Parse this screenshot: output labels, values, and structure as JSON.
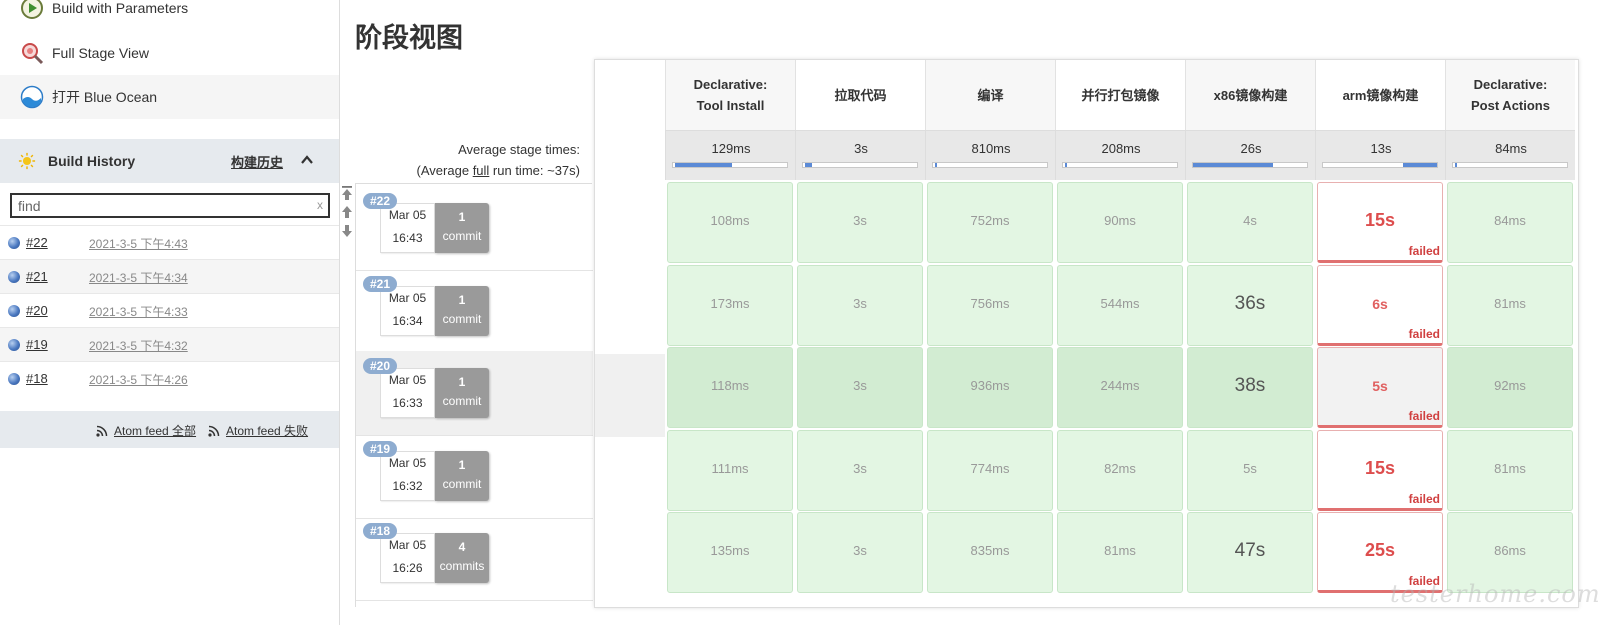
{
  "sidebar": {
    "tasks": [
      {
        "label": "Build with Parameters",
        "icon": "clock-play-icon"
      },
      {
        "label": "Full Stage View",
        "icon": "magnifier-icon"
      },
      {
        "label": "打开 Blue Ocean",
        "icon": "blue-ocean-icon"
      }
    ],
    "build_history": {
      "title": "Build History",
      "trend_label": "构建历史",
      "search_value": "find",
      "search_clear": "x",
      "builds": [
        {
          "number": "#22",
          "date": "2021-3-5 下午4:43"
        },
        {
          "number": "#21",
          "date": "2021-3-5 下午4:34"
        },
        {
          "number": "#20",
          "date": "2021-3-5 下午4:33"
        },
        {
          "number": "#19",
          "date": "2021-3-5 下午4:32"
        },
        {
          "number": "#18",
          "date": "2021-3-5 下午4:26"
        }
      ],
      "feeds": {
        "all": "Atom feed 全部",
        "failed": "Atom feed 失败"
      }
    }
  },
  "main": {
    "title": "阶段视图",
    "avg_stage_times_label": "Average stage times:",
    "avg_run_prefix": "(Average ",
    "avg_run_link": "full",
    "avg_run_suffix": " run time: ~37s)",
    "stages": [
      {
        "name1": "Declarative:",
        "name2": "Tool Install",
        "avg": "129ms",
        "progress": 0.5
      },
      {
        "name1": "拉取代码",
        "name2": "",
        "avg": "3s",
        "progress": 0.06
      },
      {
        "name1": "编译",
        "name2": "",
        "avg": "810ms",
        "progress": 0.02
      },
      {
        "name1": "并行打包镜像",
        "name2": "",
        "avg": "208ms",
        "progress": 0.01
      },
      {
        "name1": "x86镜像构建",
        "name2": "",
        "avg": "26s",
        "progress": 0.7
      },
      {
        "name1": "arm镜像构建",
        "name2": "",
        "avg": "13s",
        "progress": 0.3
      },
      {
        "name1": "Declarative:",
        "name2": "Post Actions",
        "avg": "84ms",
        "progress": 0.005
      }
    ],
    "runs": [
      {
        "badge": "#22",
        "month": "Mar 05",
        "time": "16:43",
        "commits_n": "1",
        "commits_label": "commit",
        "cells": [
          "108ms",
          "3s",
          "752ms",
          "90ms",
          "4s",
          "15s",
          "84ms"
        ]
      },
      {
        "badge": "#21",
        "month": "Mar 05",
        "time": "16:34",
        "commits_n": "1",
        "commits_label": "commit",
        "cells": [
          "173ms",
          "3s",
          "756ms",
          "544ms",
          "36s",
          "6s",
          "81ms"
        ]
      },
      {
        "badge": "#20",
        "month": "Mar 05",
        "time": "16:33",
        "commits_n": "1",
        "commits_label": "commit",
        "cells": [
          "118ms",
          "3s",
          "936ms",
          "244ms",
          "38s",
          "5s",
          "92ms"
        ]
      },
      {
        "badge": "#19",
        "month": "Mar 05",
        "time": "16:32",
        "commits_n": "1",
        "commits_label": "commit",
        "cells": [
          "111ms",
          "3s",
          "774ms",
          "82ms",
          "5s",
          "15s",
          "81ms"
        ]
      },
      {
        "badge": "#18",
        "month": "Mar 05",
        "time": "16:26",
        "commits_n": "4",
        "commits_label": "commits",
        "cells": [
          "135ms",
          "3s",
          "835ms",
          "81ms",
          "47s",
          "25s",
          "86ms"
        ]
      }
    ],
    "failed_label": "failed",
    "watermark": "testerhome.com"
  }
}
